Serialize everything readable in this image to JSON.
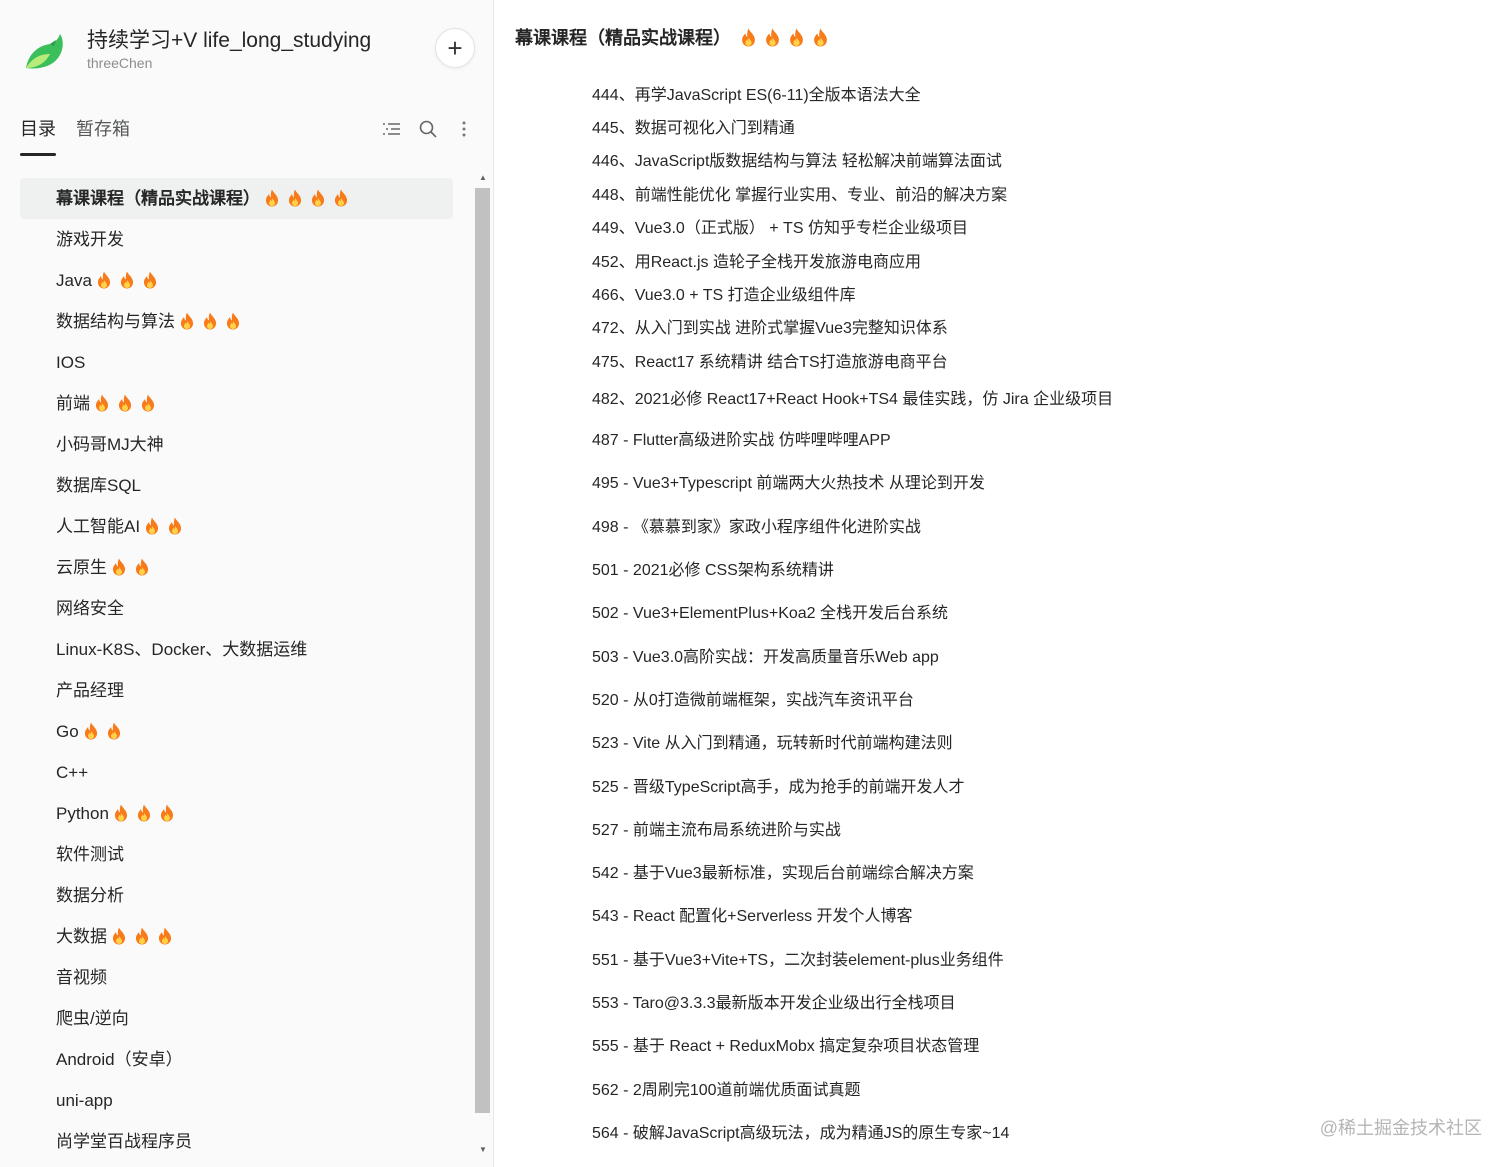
{
  "knowledge_base": {
    "title": "持续学习+V life_long_studying",
    "owner": "threeChen",
    "add_button": "+"
  },
  "tabs": [
    "目录",
    "暂存箱"
  ],
  "icons": {
    "toc_toggle": "list-icon",
    "search": "search-icon",
    "more": "more-vertical-icon",
    "fire": "fire-icon"
  },
  "sidebar": {
    "items": [
      {
        "label": "幕课课程（精品实战课程）",
        "fires": 4,
        "active": true
      },
      {
        "label": "游戏开发",
        "fires": 0
      },
      {
        "label": "Java",
        "fires": 3
      },
      {
        "label": "数据结构与算法",
        "fires": 3
      },
      {
        "label": "IOS",
        "fires": 0
      },
      {
        "label": "前端",
        "fires": 3
      },
      {
        "label": "小码哥MJ大神",
        "fires": 0
      },
      {
        "label": "数据库SQL",
        "fires": 0
      },
      {
        "label": "人工智能AI",
        "fires": 2
      },
      {
        "label": "云原生",
        "fires": 2
      },
      {
        "label": "网络安全",
        "fires": 0
      },
      {
        "label": "Linux-K8S、Docker、大数据运维",
        "fires": 0
      },
      {
        "label": "产品经理",
        "fires": 0
      },
      {
        "label": "Go",
        "fires": 2
      },
      {
        "label": "C++",
        "fires": 0
      },
      {
        "label": "Python",
        "fires": 3
      },
      {
        "label": "软件测试",
        "fires": 0
      },
      {
        "label": "数据分析",
        "fires": 0
      },
      {
        "label": "大数据",
        "fires": 3
      },
      {
        "label": "音视频",
        "fires": 0
      },
      {
        "label": "爬虫/逆向",
        "fires": 0
      },
      {
        "label": "Android（安卓）",
        "fires": 0
      },
      {
        "label": "uni-app",
        "fires": 0
      },
      {
        "label": "尚学堂百战程序员",
        "fires": 0
      }
    ]
  },
  "main": {
    "title": "幕课课程（精品实战课程）",
    "title_fires": 4,
    "courses": [
      "444、再学JavaScript ES(6-11)全版本语法大全",
      "445、数据可视化入门到精通",
      "446、JavaScript版数据结构与算法 轻松解决前端算法面试",
      "448、前端性能优化 掌握行业实用、专业、前沿的解决方案",
      "449、Vue3.0（正式版） + TS 仿知乎专栏企业级项目",
      "452、用React.js 造轮子全栈开发旅游电商应用",
      "466、Vue3.0 + TS 打造企业级组件库",
      "472、从入门到实战 进阶式掌握Vue3完整知识体系",
      "475、React17 系统精讲 结合TS打造旅游电商平台",
      "482、2021必修 React17+React Hook+TS4 最佳实践，仿 Jira 企业级项目",
      "487 - Flutter高级进阶实战 仿哔哩哔哩APP",
      "495 - Vue3+Typescript 前端两大火热技术 从理论到开发",
      "498 - 《慕慕到家》家政小程序组件化进阶实战",
      "501 - 2021必修 CSS架构系统精讲",
      "502 - Vue3+ElementPlus+Koa2 全栈开发后台系统",
      "503 - Vue3.0高阶实战：开发高质量音乐Web app",
      "520 - 从0打造微前端框架，实战汽车资讯平台",
      "523 - Vite 从入门到精通，玩转新时代前端构建法则",
      "525 - 晋级TypeScript高手，成为抢手的前端开发人才",
      "527 - 前端主流布局系统进阶与实战",
      "542 - 基于Vue3最新标准，实现后台前端综合解决方案",
      "543 - React 配置化+Serverless 开发个人博客",
      "551 - 基于Vue3+Vite+TS，二次封装element-plus业务组件",
      "553 - Taro@3.3.3最新版本开发企业级出行全栈项目",
      "555 - 基于 React + ReduxMobx 搞定复杂项目状态管理",
      "562 - 2周刷完100道前端优质面试真题",
      "564 - 破解JavaScript高级玩法，成为精通JS的原生专家~14"
    ]
  },
  "watermark": "@稀土掘金技术社区",
  "colors": {
    "fire_outer": "#f77b1a",
    "fire_inner": "#ffd24a",
    "logo_green": "#3bbf5a",
    "logo_light": "#b8ec7a"
  }
}
